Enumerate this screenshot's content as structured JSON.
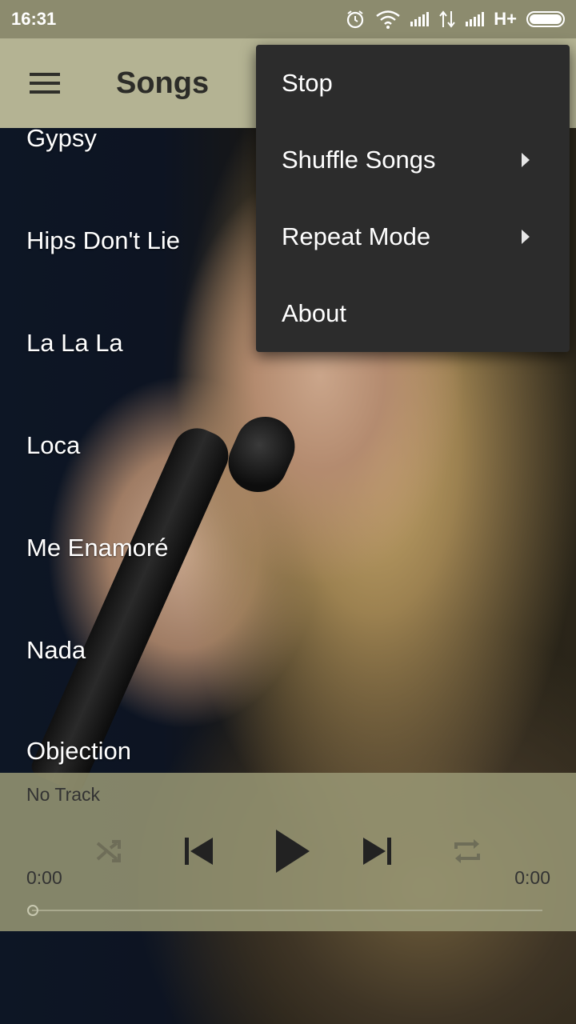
{
  "status_bar": {
    "time": "16:31",
    "network": "H+",
    "icons": [
      "alarm-icon",
      "wifi-icon",
      "signal-icon",
      "data-arrows-icon",
      "signal-icon",
      "battery-icon"
    ]
  },
  "app_bar": {
    "title": "Songs",
    "menu_icon": "hamburger-menu-icon"
  },
  "songs": [
    "Gypsy",
    "Hips Don't Lie",
    "La La La",
    "Loca",
    "Me Enamoré",
    "Nada",
    "Objection"
  ],
  "player": {
    "track": "No Track",
    "elapsed": "0:00",
    "duration": "0:00",
    "progress": 0,
    "controls": [
      "shuffle-icon",
      "previous-icon",
      "play-icon",
      "next-icon",
      "repeat-icon"
    ]
  },
  "overflow_menu": {
    "items": [
      {
        "label": "Stop",
        "has_submenu": false
      },
      {
        "label": "Shuffle Songs",
        "has_submenu": true
      },
      {
        "label": "Repeat Mode",
        "has_submenu": true
      },
      {
        "label": "About",
        "has_submenu": false
      }
    ]
  },
  "colors": {
    "app_bar": "#b4b393",
    "status_bar": "#8c8b6e",
    "player_panel": "#989774",
    "menu_background": "#2c2c2c"
  }
}
